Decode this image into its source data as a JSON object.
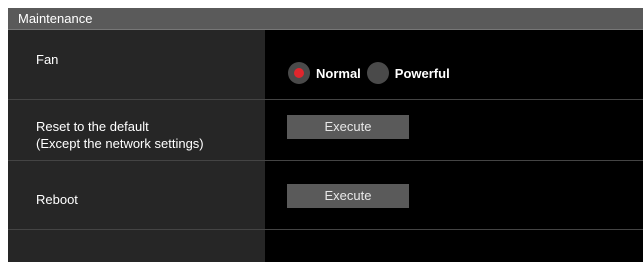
{
  "section": {
    "title": "Maintenance"
  },
  "fan": {
    "label": "Fan",
    "options": [
      {
        "label": "Normal",
        "selected": true
      },
      {
        "label": "Powerful",
        "selected": false
      }
    ],
    "accent_color": "#e0262d"
  },
  "reset": {
    "label_line1": "Reset to the default",
    "label_line2": "(Except the network settings)",
    "button_label": "Execute"
  },
  "reboot": {
    "label": "Reboot",
    "button_label": "Execute"
  }
}
